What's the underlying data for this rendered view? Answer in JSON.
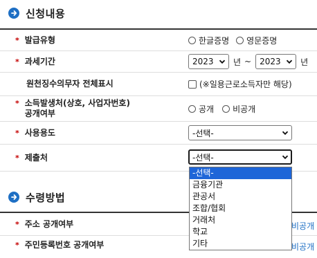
{
  "sections": {
    "apply": {
      "title": "신청내용"
    },
    "receive": {
      "title": "수령방법"
    }
  },
  "colors": {
    "accent": "#1e6fc4",
    "required": "#c40000",
    "selected_option": "#1e66d8"
  },
  "rows": {
    "issue_type": {
      "label": "발급유형",
      "required": true,
      "options": [
        "한글증명",
        "영문증명"
      ]
    },
    "tax_period": {
      "label": "과세기간",
      "required": true,
      "start_year": "2023",
      "end_year": "2023",
      "year_unit": "년",
      "separator": "~"
    },
    "show_all": {
      "label": "원천징수의무자 전체표시",
      "required": false,
      "checkbox_label": "(※일용근로소득자만 해당)"
    },
    "disclosure": {
      "label_line1": "소득발생처(상호, 사업자번호)",
      "label_line2": "공개여부",
      "required": true,
      "options": [
        "공개",
        "비공개"
      ]
    },
    "purpose": {
      "label": "사용용도",
      "required": true,
      "selected": "-선택-"
    },
    "submit_to": {
      "label": "제출처",
      "required": true,
      "selected": "-선택-",
      "dropdown_options": [
        "-선택-",
        "금융기관",
        "관공서",
        "조합/협회",
        "거래처",
        "학교",
        "기타"
      ]
    }
  },
  "receive_rows": {
    "address_disclosure": {
      "label": "주소 공개여부",
      "right_text": "비공개"
    },
    "rrn_disclosure": {
      "label": "주민등록번호 공개여부",
      "right_text": "비공개"
    }
  },
  "star": "*"
}
